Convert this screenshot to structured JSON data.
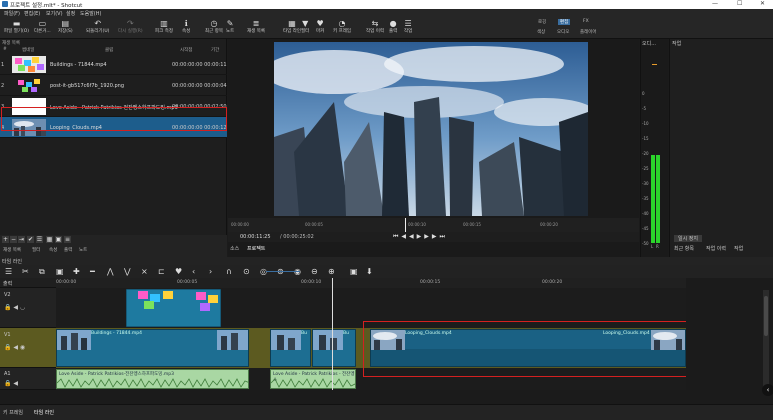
{
  "window": {
    "title": "프로젝트 설정.mlt* - Shotcut",
    "controls": [
      "—",
      "☐",
      "✕"
    ]
  },
  "menu": [
    "파일(F)",
    "편집(E)",
    "보기(V)",
    "설정",
    "도움말(H)"
  ],
  "toolbar": [
    {
      "icon": "folder-icon",
      "glyph": "▬",
      "label": "파일 열기(O)"
    },
    {
      "icon": "folder-more-icon",
      "glyph": "▭",
      "label": "다른거..."
    },
    {
      "icon": "save-icon",
      "glyph": "▤",
      "label": "저장(S)"
    },
    {
      "icon": "undo-icon",
      "glyph": "↶",
      "label": "되돌리기(U)"
    },
    {
      "icon": "redo-icon",
      "glyph": "↷",
      "label": "다시 실행(R)"
    },
    {
      "icon": "peak-meter-icon",
      "glyph": "▥",
      "label": "피크 측정"
    },
    {
      "icon": "info-icon",
      "glyph": "ℹ",
      "label": "속성"
    },
    {
      "icon": "recent-icon",
      "glyph": "◷",
      "label": "최근 항목"
    },
    {
      "icon": "notes-icon",
      "glyph": "✎",
      "label": "노트"
    },
    {
      "icon": "playlist-icon",
      "glyph": "≣",
      "label": "재생 목록"
    },
    {
      "icon": "timeline-icon",
      "glyph": "▦",
      "label": "타임 라인"
    },
    {
      "icon": "filter-icon",
      "glyph": "▼",
      "label": "필터"
    },
    {
      "icon": "marker-icon",
      "glyph": "♥",
      "label": "마커"
    },
    {
      "icon": "keyframes-icon",
      "glyph": "◔",
      "label": "키 프레임"
    },
    {
      "icon": "history-icon",
      "glyph": "⇆",
      "label": "작업 이력"
    },
    {
      "icon": "export-icon",
      "glyph": "●",
      "label": "출력"
    },
    {
      "icon": "jobs-icon",
      "glyph": "☰",
      "label": "작업"
    }
  ],
  "layouts": {
    "top": [
      "로깅",
      "편집",
      "FX"
    ],
    "bottom": [
      "색상",
      "오디오",
      "플레이어"
    ],
    "selected": "편집"
  },
  "playlist": {
    "title": "재생 목록",
    "columns": [
      "#",
      "썸네일",
      "클립",
      "시작점",
      "기간"
    ],
    "items": [
      {
        "n": "1",
        "name": "Buildings - 71844.mp4",
        "in": "00:00:00:00",
        "dur": "00:00:11"
      },
      {
        "n": "2",
        "name": "post-it-gb517c6f7b_1920.png",
        "in": "00:00:00:00",
        "dur": "00:00:04"
      },
      {
        "n": "3",
        "name": "Love Aside - Patrick Patrikios-전잔멩스하프파도밍.mp3",
        "in": "00:00:00:00",
        "dur": "00:02:50"
      },
      {
        "n": "4",
        "name": "Looping_Clouds.mp4",
        "in": "00:00:00:00",
        "dur": "00:00:12"
      }
    ],
    "selected_index": 3,
    "buttons": [
      "+",
      "−",
      "⇥",
      "✔",
      "☰",
      "▦",
      "▣",
      "≡"
    ],
    "tabs": [
      "재생 목록",
      "필터",
      "속성",
      "출력",
      "노트"
    ]
  },
  "viewer": {
    "ruler_ticks": [
      "00:00:00",
      "00:00:05",
      "00:00:10",
      "00:00:15",
      "00:00:20"
    ],
    "timecode": "00:00:11:25",
    "duration": "/ 00:00:25:02",
    "tabs": [
      "소스",
      "프로젝트"
    ],
    "active_tab": "프로젝트"
  },
  "meters": {
    "title": "오디...",
    "scale": [
      "0",
      "-5",
      "-10",
      "-15",
      "-20",
      "-25",
      "-30",
      "-35",
      "-40",
      "-45",
      "-50"
    ],
    "channels": [
      "L",
      "R"
    ],
    "level": 0.55
  },
  "properties": {
    "title": "작업",
    "button": "일시 정지",
    "tabs": [
      "최근 항목",
      "작업 이력",
      "작업"
    ]
  },
  "timeline": {
    "title": "타임 라인",
    "ruler": [
      "00:00:00",
      "00:00:05",
      "00:00:10",
      "00:00:15",
      "00:00:20"
    ],
    "tracks": [
      "출력",
      "V2",
      "V1",
      "A1"
    ],
    "clips": {
      "v1": [
        "Buildings - 71844.mp4",
        "Bu",
        "Bu",
        "Looping_Clouds.mp4",
        "Looping_Clouds.mp4"
      ],
      "a1": [
        "Love Aside - Patrick Patrikios-전잔멩스하프파도밍.mp3",
        "Love Aside - Patrick Patrikios - 전잔멩스"
      ]
    },
    "tools": [
      "☰",
      "✂",
      "⧉",
      "▣",
      "✚",
      "━",
      "⋀",
      "⋁",
      "⨯",
      "⊏",
      "♥",
      "‹",
      "›",
      "∩",
      "⊙",
      "◎",
      "⊛",
      "◉",
      "⊖",
      "⊕",
      "▣",
      "⬇"
    ]
  },
  "status": {
    "tabs": [
      "키 프레임",
      "타임 라인"
    ]
  }
}
